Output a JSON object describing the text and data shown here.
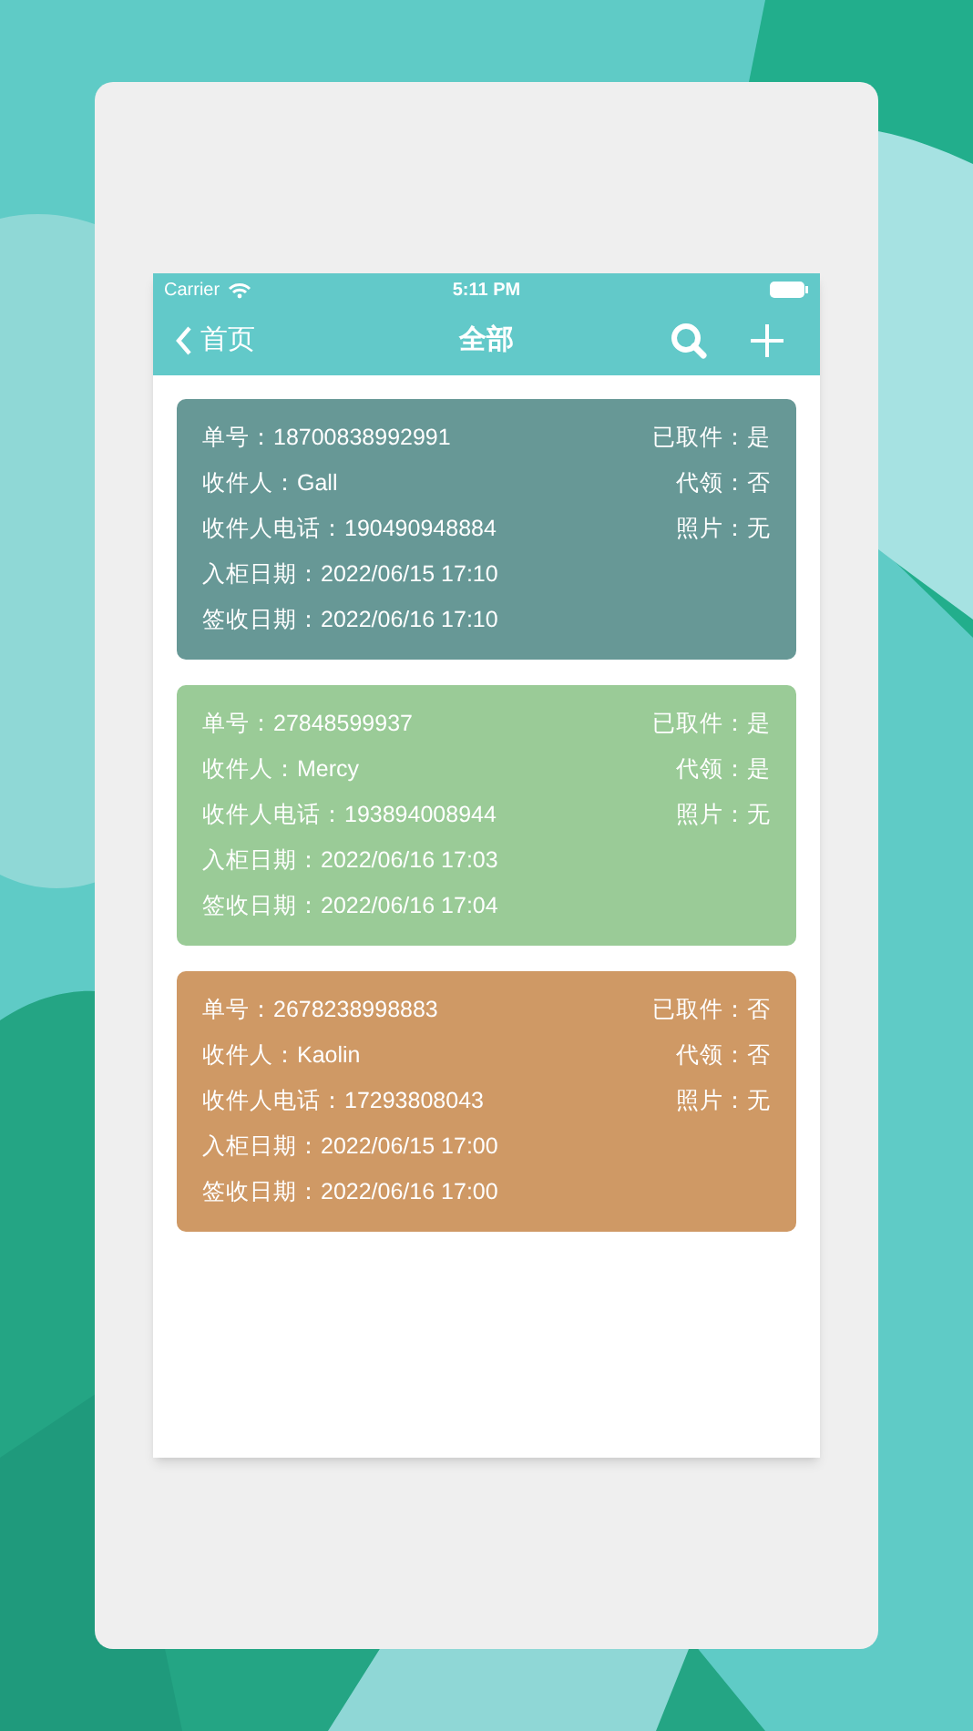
{
  "status_bar": {
    "carrier": "Carrier",
    "time": "5:11 PM"
  },
  "nav": {
    "back": "首页",
    "title": "全部"
  },
  "cards": [
    {
      "color": "#679896",
      "lines": [
        "单号：18700838992991",
        "收件人：Gall",
        "收件人电话：190490948884",
        "入柜日期：2022/06/15 17:10",
        "签收日期：2022/06/16 17:10"
      ],
      "flags": [
        "已取件：是",
        "代领：否",
        "照片：无"
      ]
    },
    {
      "color": "#9acb97",
      "lines": [
        "单号：27848599937",
        "收件人：Mercy",
        "收件人电话：193894008944",
        "入柜日期：2022/06/16 17:03",
        "签收日期：2022/06/16 17:04"
      ],
      "flags": [
        "已取件：是",
        "代领：是",
        "照片：无"
      ]
    },
    {
      "color": "#cf9965",
      "lines": [
        "单号：2678238998883",
        "收件人：Kaolin",
        "收件人电话：17293808043",
        "入柜日期：2022/06/15 17:00",
        "签收日期：2022/06/16 17:00"
      ],
      "flags": [
        "已取件：否",
        "代领：否",
        "照片：无"
      ]
    }
  ]
}
